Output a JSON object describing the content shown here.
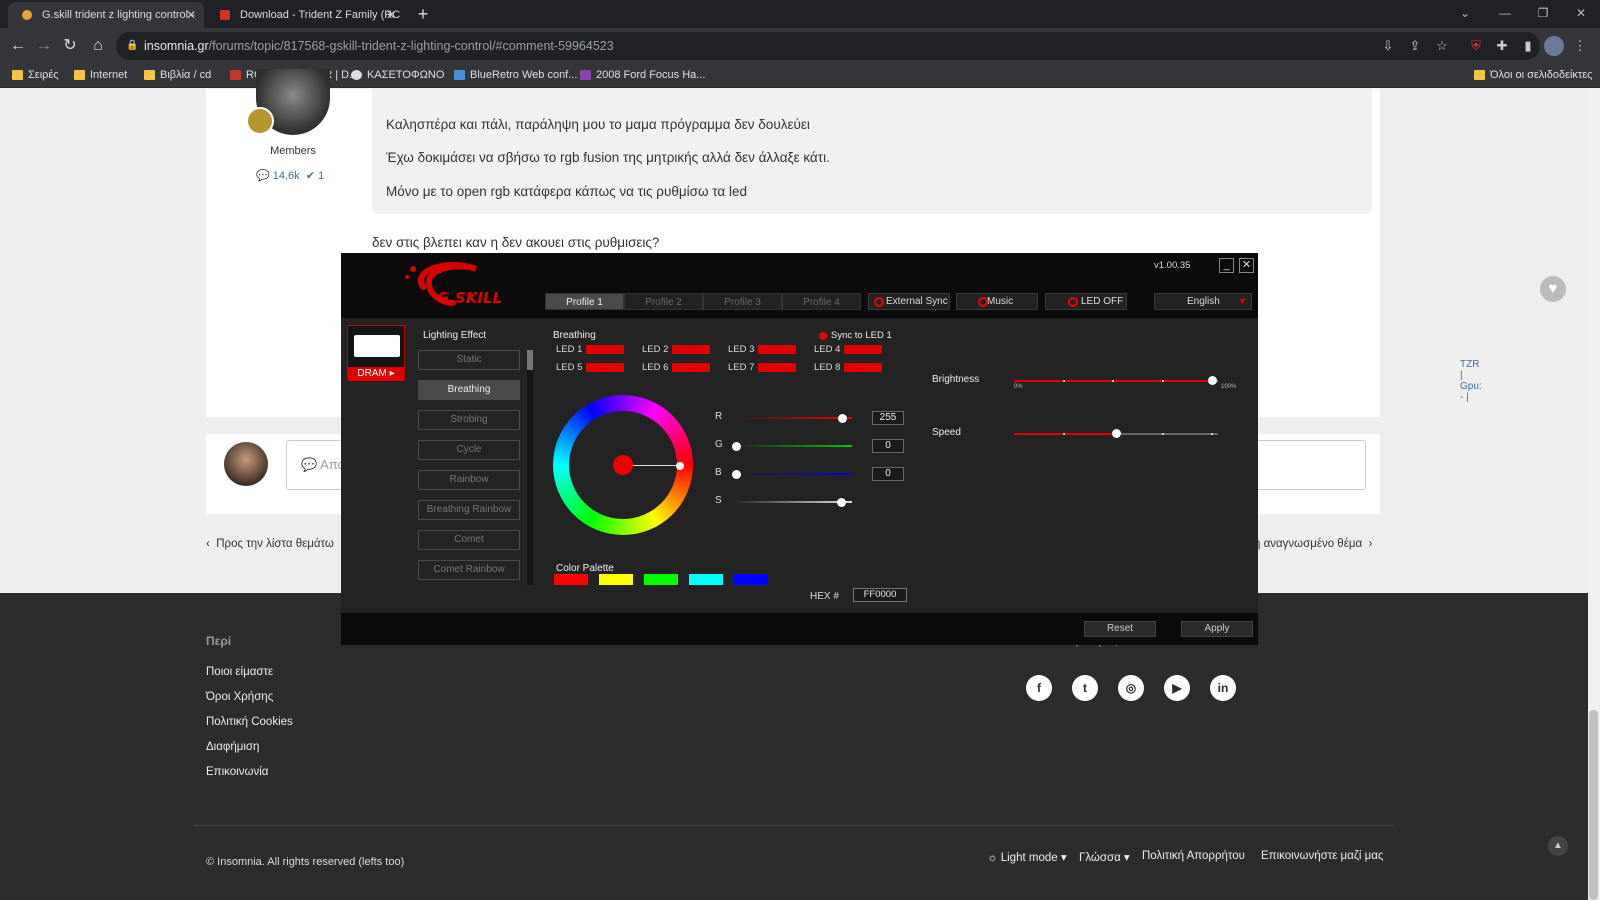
{
  "browser": {
    "tabs": [
      {
        "title": "G.skill trident z lighting control -",
        "active": true,
        "favicon_color": "#e8a33d"
      },
      {
        "title": "Download - Trident Z Family (RC",
        "active": false,
        "favicon_color": "#d93025"
      }
    ],
    "new_tab": "+",
    "window_controls": [
      "⌄",
      "—",
      "❐",
      "✕"
    ],
    "url_host": "insomnia.gr",
    "url_path": "/forums/topic/817568-gskill-trident-z-lighting-control/#comment-59964523",
    "bookmarks": [
      {
        "label": "Σειρές",
        "icon": "folder-icon",
        "color": "#f4c542"
      },
      {
        "label": "Internet",
        "icon": "folder-icon",
        "color": "#f4c542"
      },
      {
        "label": "Βιβλία / cd",
        "icon": "folder-icon",
        "color": "#f4c542"
      },
      {
        "label": "ROMSFOREVER | D...",
        "icon": "romsforever-icon",
        "color": "#c0392b"
      },
      {
        "label": "ΚΑΣΕΤΟΦΩΝΟ",
        "icon": "headphones-icon",
        "color": "#dddddd"
      },
      {
        "label": "BlueRetro Web conf...",
        "icon": "blueretro-icon",
        "color": "#4a90d9"
      },
      {
        "label": "2008 Ford Focus Ha...",
        "icon": "ford-icon",
        "color": "#8e44ad"
      }
    ],
    "all_bookmarks": "Όλοι οι σελιδοδείκτες"
  },
  "post": {
    "role": "Members",
    "stats_posts": "14,6k",
    "stats_badges": "1",
    "quote_lines": [
      "Καλησπέρα και πάλι, παράληψη μου το μαμα πρόγραμμα δεν δουλεύει",
      "Έχω δοκιμάσει να σβήσω  το rgb fusion της μητρικής αλλά δεν άλλαξε κάτι.",
      "Μόνο με το open rgb κατάφερα κάπως να τις ρυθμίσω τα led"
    ],
    "reply_text": "δεν στις βλεπει καν η δεν ακουει στις ρυθμισεις?",
    "signature_fragment": "TZR | Gpu: - |"
  },
  "compose": {
    "placeholder": "Απα"
  },
  "nav": {
    "prev": "Προς την λίστα θεμάτω",
    "next": "η αναγνωσμένο θέμα"
  },
  "footer": {
    "heading": "Περί",
    "links": [
      "Ποιοι είμαστε",
      "Όροι Χρήσης",
      "Πολιτική Cookies",
      "Διαφήμιση",
      "Επικοινωνία"
    ],
    "follow_heading": "Ακολουθήστε μας",
    "social": [
      {
        "name": "facebook-icon",
        "glyph": "f"
      },
      {
        "name": "twitter-icon",
        "glyph": "t"
      },
      {
        "name": "instagram-icon",
        "glyph": "◎"
      },
      {
        "name": "youtube-icon",
        "glyph": "▶"
      },
      {
        "name": "linkedin-icon",
        "glyph": "in"
      }
    ],
    "copyright": "© Insomnia. All rights reserved (lefts too)",
    "light_mode": "☼ Light mode ▾",
    "language": "Γλώσσα ▾",
    "privacy": "Πολιτική Απορρήτου",
    "contact": "Επικοινωνήστε μαζί μας"
  },
  "gskill": {
    "version": "v1.00.35",
    "logo_text": "G.SKILL",
    "minimize": "_",
    "close": "✕",
    "profiles": [
      "Profile 1",
      "Profile 2",
      "Profile 3",
      "Profile 4"
    ],
    "active_profile": 0,
    "external_sync": "External Sync",
    "music": "Music",
    "led_off": "LED OFF",
    "language": "English",
    "device_label": "DRAM",
    "lighting_effect_title": "Lighting Effect",
    "effects": [
      "Static",
      "Breathing",
      "Strobing",
      "Cycle",
      "Rainbow",
      "Breathing Rainbow",
      "Comet",
      "Comet Rainbow"
    ],
    "active_effect": 1,
    "current_effect": "Breathing",
    "sync_to_led": "Sync to LED 1",
    "leds": [
      "LED 1",
      "LED 2",
      "LED 3",
      "LED 4",
      "LED 5",
      "LED 6",
      "LED 7",
      "LED 8"
    ],
    "led_color": "#e00000",
    "rgb": {
      "r_label": "R",
      "r_value": "255",
      "g_label": "G",
      "g_value": "0",
      "b_label": "B",
      "b_value": "0",
      "s_label": "S"
    },
    "hex_label": "HEX #",
    "hex_value": "FF0000",
    "palette_title": "Color Palette",
    "palette": [
      "#ff0000",
      "#ffff00",
      "#00ff00",
      "#00ffff",
      "#0000ff"
    ],
    "brightness_label": "Brightness",
    "brightness_level": 1.0,
    "brightness_min": "0%",
    "brightness_max": "100%",
    "speed_label": "Speed",
    "speed_level": 0.5,
    "reset": "Reset",
    "apply": "Apply"
  }
}
